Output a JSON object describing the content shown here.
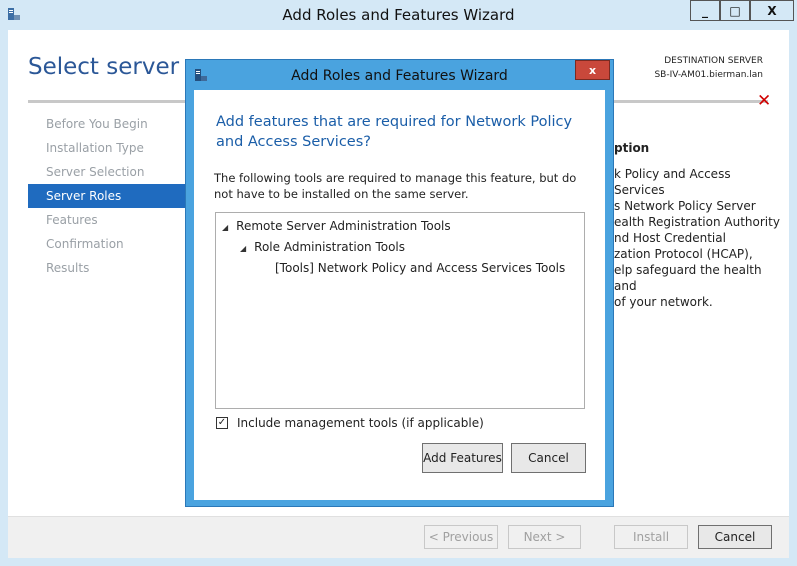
{
  "outer_window": {
    "title": "Add Roles and Features Wizard",
    "controls": {
      "minimize": "_",
      "maximize": "□",
      "close": "X"
    }
  },
  "page": {
    "title": "Select server ro",
    "destination_label": "DESTINATION SERVER",
    "destination_server": "SB-IV-AM01.bierman.lan",
    "error_icon": "red-x-icon"
  },
  "nav": {
    "items": [
      {
        "label": "Before You Begin"
      },
      {
        "label": "Installation Type"
      },
      {
        "label": "Server Selection"
      },
      {
        "label": "Server Roles"
      },
      {
        "label": "Features"
      },
      {
        "label": "Confirmation"
      },
      {
        "label": "Results"
      }
    ],
    "active_index": 3
  },
  "description": {
    "heading": "ption",
    "lines": [
      "k Policy and Access Services",
      "s Network Policy Server",
      "ealth Registration Authority",
      "nd Host Credential",
      "zation Protocol (HCAP),",
      "elp safeguard the health and",
      "of your network."
    ]
  },
  "footer": {
    "previous": "< Previous",
    "next": "Next >",
    "install": "Install",
    "cancel": "Cancel"
  },
  "modal": {
    "title": "Add Roles and Features Wizard",
    "close_label": "x",
    "heading": "Add features that are required for Network Policy and Access Services?",
    "description": "The following tools are required to manage this feature, but do not have to be installed on the same server.",
    "tree": [
      {
        "label": "Remote Server Administration Tools",
        "expanded": true
      },
      {
        "label": "Role Administration Tools",
        "expanded": true
      },
      {
        "label": "[Tools] Network Policy and Access Services Tools"
      }
    ],
    "include_tools_label": "Include management tools (if applicable)",
    "include_tools_checked": true,
    "add_features_button": "Add Features",
    "cancel_button": "Cancel"
  },
  "colors": {
    "accent": "#1f6bbf",
    "modal_frame": "#4aa3df",
    "heading_blue": "#1b5ea8",
    "close_red": "#c9483b",
    "error_red": "#d10000"
  }
}
